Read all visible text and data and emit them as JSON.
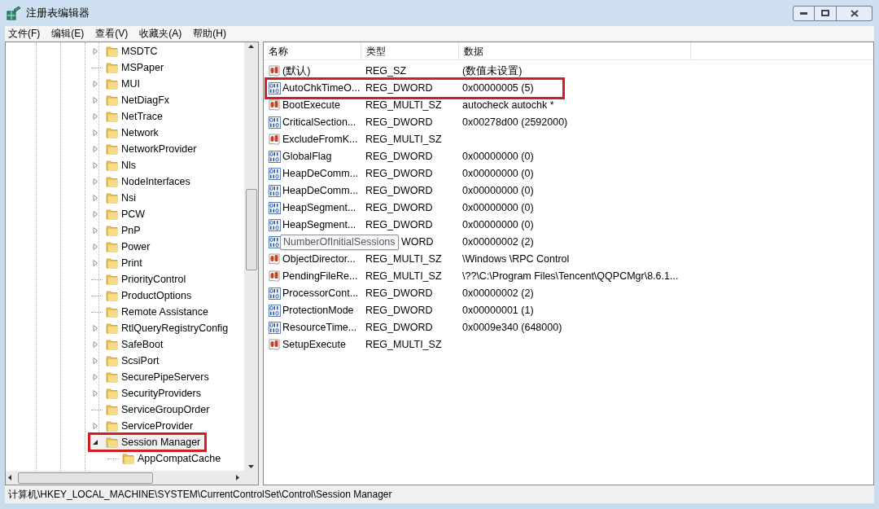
{
  "window": {
    "title": "注册表编辑器"
  },
  "menu": [
    "文件(F)",
    "编辑(E)",
    "查看(V)",
    "收藏夹(A)",
    "帮助(H)"
  ],
  "tree": [
    {
      "label": "MSDTC",
      "expandable": true,
      "expanded": false,
      "selected": false,
      "highlighted": false
    },
    {
      "label": "MSPaper",
      "expandable": false,
      "selected": false,
      "highlighted": false
    },
    {
      "label": "MUI",
      "expandable": true,
      "expanded": false,
      "selected": false,
      "highlighted": false
    },
    {
      "label": "NetDiagFx",
      "expandable": true,
      "expanded": false,
      "selected": false,
      "highlighted": false
    },
    {
      "label": "NetTrace",
      "expandable": true,
      "expanded": false,
      "selected": false,
      "highlighted": false
    },
    {
      "label": "Network",
      "expandable": true,
      "expanded": false,
      "selected": false,
      "highlighted": false
    },
    {
      "label": "NetworkProvider",
      "expandable": true,
      "expanded": false,
      "selected": false,
      "highlighted": false
    },
    {
      "label": "Nls",
      "expandable": true,
      "expanded": false,
      "selected": false,
      "highlighted": false
    },
    {
      "label": "NodeInterfaces",
      "expandable": true,
      "expanded": false,
      "selected": false,
      "highlighted": false
    },
    {
      "label": "Nsi",
      "expandable": true,
      "expanded": false,
      "selected": false,
      "highlighted": false
    },
    {
      "label": "PCW",
      "expandable": true,
      "expanded": false,
      "selected": false,
      "highlighted": false
    },
    {
      "label": "PnP",
      "expandable": true,
      "expanded": false,
      "selected": false,
      "highlighted": false
    },
    {
      "label": "Power",
      "expandable": true,
      "expanded": false,
      "selected": false,
      "highlighted": false
    },
    {
      "label": "Print",
      "expandable": true,
      "expanded": false,
      "selected": false,
      "highlighted": false
    },
    {
      "label": "PriorityControl",
      "expandable": false,
      "selected": false,
      "highlighted": false
    },
    {
      "label": "ProductOptions",
      "expandable": false,
      "selected": false,
      "highlighted": false
    },
    {
      "label": "Remote Assistance",
      "expandable": false,
      "selected": false,
      "highlighted": false
    },
    {
      "label": "RtlQueryRegistryConfig",
      "expandable": true,
      "expanded": false,
      "selected": false,
      "highlighted": false
    },
    {
      "label": "SafeBoot",
      "expandable": true,
      "expanded": false,
      "selected": false,
      "highlighted": false
    },
    {
      "label": "ScsiPort",
      "expandable": true,
      "expanded": false,
      "selected": false,
      "highlighted": false
    },
    {
      "label": "SecurePipeServers",
      "expandable": true,
      "expanded": false,
      "selected": false,
      "highlighted": false
    },
    {
      "label": "SecurityProviders",
      "expandable": true,
      "expanded": false,
      "selected": false,
      "highlighted": false
    },
    {
      "label": "ServiceGroupOrder",
      "expandable": false,
      "selected": false,
      "highlighted": false
    },
    {
      "label": "ServiceProvider",
      "expandable": true,
      "expanded": false,
      "selected": false,
      "highlighted": false
    },
    {
      "label": "Session Manager",
      "expandable": true,
      "expanded": true,
      "selected": true,
      "highlighted": true,
      "children": [
        {
          "label": "AppCompatCache",
          "expandable": false,
          "selected": false,
          "highlighted": false
        }
      ]
    }
  ],
  "columns": [
    "名称",
    "类型",
    "数据"
  ],
  "rows": [
    {
      "kind": "string",
      "name": "(默认)",
      "type": "REG_SZ",
      "data": "(数值未设置)",
      "highlighted": false
    },
    {
      "kind": "binary",
      "name": "AutoChkTimeO...",
      "type": "REG_DWORD",
      "data": "0x00000005 (5)",
      "highlighted": true
    },
    {
      "kind": "string",
      "name": "BootExecute",
      "type": "REG_MULTI_SZ",
      "data": "autocheck autochk *",
      "highlighted": false
    },
    {
      "kind": "binary",
      "name": "CriticalSection...",
      "type": "REG_DWORD",
      "data": "0x00278d00 (2592000)",
      "highlighted": false
    },
    {
      "kind": "string",
      "name": "ExcludeFromK...",
      "type": "REG_MULTI_SZ",
      "highlighted": false
    },
    {
      "kind": "binary",
      "name": "GlobalFlag",
      "type": "REG_DWORD",
      "data": "0x00000000 (0)",
      "highlighted": false
    },
    {
      "kind": "binary",
      "name": "HeapDeComm...",
      "type": "REG_DWORD",
      "data": "0x00000000 (0)",
      "highlighted": false
    },
    {
      "kind": "binary",
      "name": "HeapDeComm...",
      "type": "REG_DWORD",
      "data": "0x00000000 (0)",
      "highlighted": false
    },
    {
      "kind": "binary",
      "name": "HeapSegment...",
      "type": "REG_DWORD",
      "data": "0x00000000 (0)",
      "highlighted": false
    },
    {
      "kind": "binary",
      "name": "HeapSegment...",
      "type": "REG_DWORD",
      "data": "0x00000000 (0)",
      "highlighted": false
    },
    {
      "kind": "binary",
      "tooltip": "NumberOfInitialSessions",
      "type": "WORD",
      "data": "0x00000002 (2)",
      "highlighted": false
    },
    {
      "kind": "string",
      "name": "ObjectDirector...",
      "type": "REG_MULTI_SZ",
      "data": "\\Windows \\RPC Control",
      "highlighted": false
    },
    {
      "kind": "string",
      "name": "PendingFileRe...",
      "type": "REG_MULTI_SZ",
      "data": "\\??\\C:\\Program Files\\Tencent\\QQPCMgr\\8.6.1...",
      "highlighted": false
    },
    {
      "kind": "binary",
      "name": "ProcessorCont...",
      "type": "REG_DWORD",
      "data": "0x00000002 (2)",
      "highlighted": false
    },
    {
      "kind": "binary",
      "name": "ProtectionMode",
      "type": "REG_DWORD",
      "data": "0x00000001 (1)",
      "highlighted": false
    },
    {
      "kind": "binary",
      "name": "ResourceTime...",
      "type": "REG_DWORD",
      "data": "0x0009e340 (648000)",
      "highlighted": false
    },
    {
      "kind": "string",
      "name": "SetupExecute",
      "type": "REG_MULTI_SZ",
      "highlighted": false
    }
  ],
  "status_bar": "计算机\\HKEY_LOCAL_MACHINE\\SYSTEM\\CurrentControlSet\\Control\\Session Manager"
}
